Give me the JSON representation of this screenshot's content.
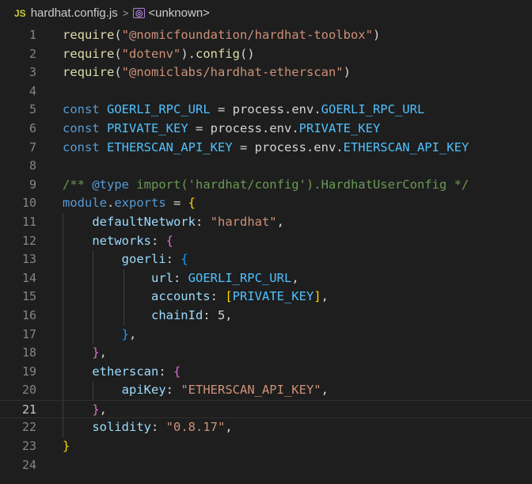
{
  "breadcrumb": {
    "file_badge": "JS",
    "file_name": "hardhat.config.js",
    "separator": ">",
    "symbol_icon": "symbol-icon",
    "symbol": "<unknown>"
  },
  "editor": {
    "current_line": 21,
    "line_numbers": [
      "1",
      "2",
      "3",
      "4",
      "5",
      "6",
      "7",
      "8",
      "9",
      "10",
      "11",
      "12",
      "13",
      "14",
      "15",
      "16",
      "17",
      "18",
      "19",
      "20",
      "21",
      "22",
      "23",
      "24"
    ],
    "lines": [
      [
        [
          "fn",
          "require"
        ],
        [
          "plain",
          "("
        ],
        [
          "str",
          "\"@nomicfoundation/hardhat-toolbox\""
        ],
        [
          "plain",
          ")"
        ]
      ],
      [
        [
          "fn",
          "require"
        ],
        [
          "plain",
          "("
        ],
        [
          "str",
          "\"dotenv\""
        ],
        [
          "plain",
          ")."
        ],
        [
          "fn",
          "config"
        ],
        [
          "plain",
          "()"
        ]
      ],
      [
        [
          "fn",
          "require"
        ],
        [
          "plain",
          "("
        ],
        [
          "str",
          "\"@nomiclabs/hardhat-etherscan\""
        ],
        [
          "plain",
          ")"
        ]
      ],
      [],
      [
        [
          "kw",
          "const"
        ],
        [
          "plain",
          " "
        ],
        [
          "const",
          "GOERLI_RPC_URL"
        ],
        [
          "plain",
          " = process.env."
        ],
        [
          "const",
          "GOERLI_RPC_URL"
        ]
      ],
      [
        [
          "kw",
          "const"
        ],
        [
          "plain",
          " "
        ],
        [
          "const",
          "PRIVATE_KEY"
        ],
        [
          "plain",
          " = process.env."
        ],
        [
          "const",
          "PRIVATE_KEY"
        ]
      ],
      [
        [
          "kw",
          "const"
        ],
        [
          "plain",
          " "
        ],
        [
          "const",
          "ETHERSCAN_API_KEY"
        ],
        [
          "plain",
          " = process.env."
        ],
        [
          "const",
          "ETHERSCAN_API_KEY"
        ]
      ],
      [],
      [
        [
          "com",
          "/** "
        ],
        [
          "kw",
          "@type"
        ],
        [
          "com",
          " import('hardhat/config').HardhatUserConfig */"
        ]
      ],
      [
        [
          "kw",
          "module"
        ],
        [
          "plain",
          "."
        ],
        [
          "kw",
          "exports"
        ],
        [
          "plain",
          " = "
        ],
        [
          "bracket",
          "{"
        ]
      ],
      [
        [
          "plain",
          "    "
        ],
        [
          "var",
          "defaultNetwork"
        ],
        [
          "plain",
          ": "
        ],
        [
          "str",
          "\"hardhat\""
        ],
        [
          "plain",
          ","
        ]
      ],
      [
        [
          "plain",
          "    "
        ],
        [
          "var",
          "networks"
        ],
        [
          "plain",
          ": "
        ],
        [
          "bracket2",
          "{"
        ]
      ],
      [
        [
          "plain",
          "        "
        ],
        [
          "var",
          "goerli"
        ],
        [
          "plain",
          ": "
        ],
        [
          "bracket3",
          "{"
        ]
      ],
      [
        [
          "plain",
          "            "
        ],
        [
          "var",
          "url"
        ],
        [
          "plain",
          ": "
        ],
        [
          "const",
          "GOERLI_RPC_URL"
        ],
        [
          "plain",
          ","
        ]
      ],
      [
        [
          "plain",
          "            "
        ],
        [
          "var",
          "accounts"
        ],
        [
          "plain",
          ": "
        ],
        [
          "bracket",
          "["
        ],
        [
          "const",
          "PRIVATE_KEY"
        ],
        [
          "bracket",
          "]"
        ],
        [
          "plain",
          ","
        ]
      ],
      [
        [
          "plain",
          "            "
        ],
        [
          "var",
          "chainId"
        ],
        [
          "plain",
          ": 5,"
        ]
      ],
      [
        [
          "plain",
          "        "
        ],
        [
          "bracket3",
          "}"
        ],
        [
          "plain",
          ","
        ]
      ],
      [
        [
          "plain",
          "    "
        ],
        [
          "bracket2",
          "}"
        ],
        [
          "plain",
          ","
        ]
      ],
      [
        [
          "plain",
          "    "
        ],
        [
          "var",
          "etherscan"
        ],
        [
          "plain",
          ": "
        ],
        [
          "bracket2",
          "{"
        ]
      ],
      [
        [
          "plain",
          "        "
        ],
        [
          "var",
          "apiKey"
        ],
        [
          "plain",
          ": "
        ],
        [
          "str",
          "\"ETHERSCAN_API_KEY\""
        ],
        [
          "plain",
          ","
        ]
      ],
      [
        [
          "plain",
          "    "
        ],
        [
          "bracket2",
          "}"
        ],
        [
          "plain",
          ","
        ]
      ],
      [
        [
          "plain",
          "    "
        ],
        [
          "var",
          "solidity"
        ],
        [
          "plain",
          ": "
        ],
        [
          "str",
          "\"0.8.17\""
        ],
        [
          "plain",
          ","
        ]
      ],
      [
        [
          "bracket",
          "}"
        ]
      ],
      []
    ]
  }
}
